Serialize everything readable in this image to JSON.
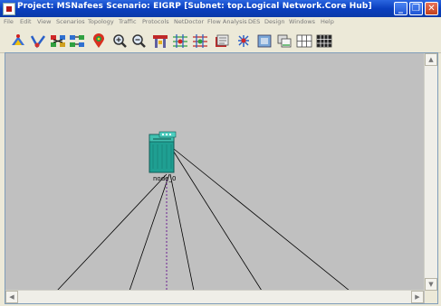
{
  "window": {
    "title": "Project: MSNafees Scenario: EIGRP  [Subnet: top.Logical Network.Core Hub]",
    "minimize_glyph": "_",
    "restore_glyph": "❐",
    "close_glyph": "✕"
  },
  "menu": [
    "File",
    "Edit",
    "View",
    "Scenarios",
    "Topology",
    "Traffic",
    "Protocols",
    "NetDoctor",
    "Flow Analysis",
    "DES",
    "Design",
    "Windows",
    "Help"
  ],
  "toolbar": {
    "tools": [
      "open-object-palette-icon",
      "verify-links-icon",
      "fail-node-icon",
      "recover-node-icon",
      "return-to-parent-icon",
      "zoom-in-icon",
      "zoom-out-icon",
      "configure-discrete-event-simulation-icon",
      "view-simulation-results-icon",
      "hide-graphs-icon",
      "import-topology-icon",
      "flow-analysis-icon",
      "network-browser-icon",
      "graph-icon",
      "tile-icon"
    ]
  },
  "workspace": {
    "node_label": "node_0",
    "link_color": "#000000",
    "demand_color": "#7a3a9a",
    "node_color": "#1f9f92"
  },
  "scrollbars": {
    "up": "▲",
    "down": "▼",
    "left": "◀",
    "right": "▶"
  }
}
